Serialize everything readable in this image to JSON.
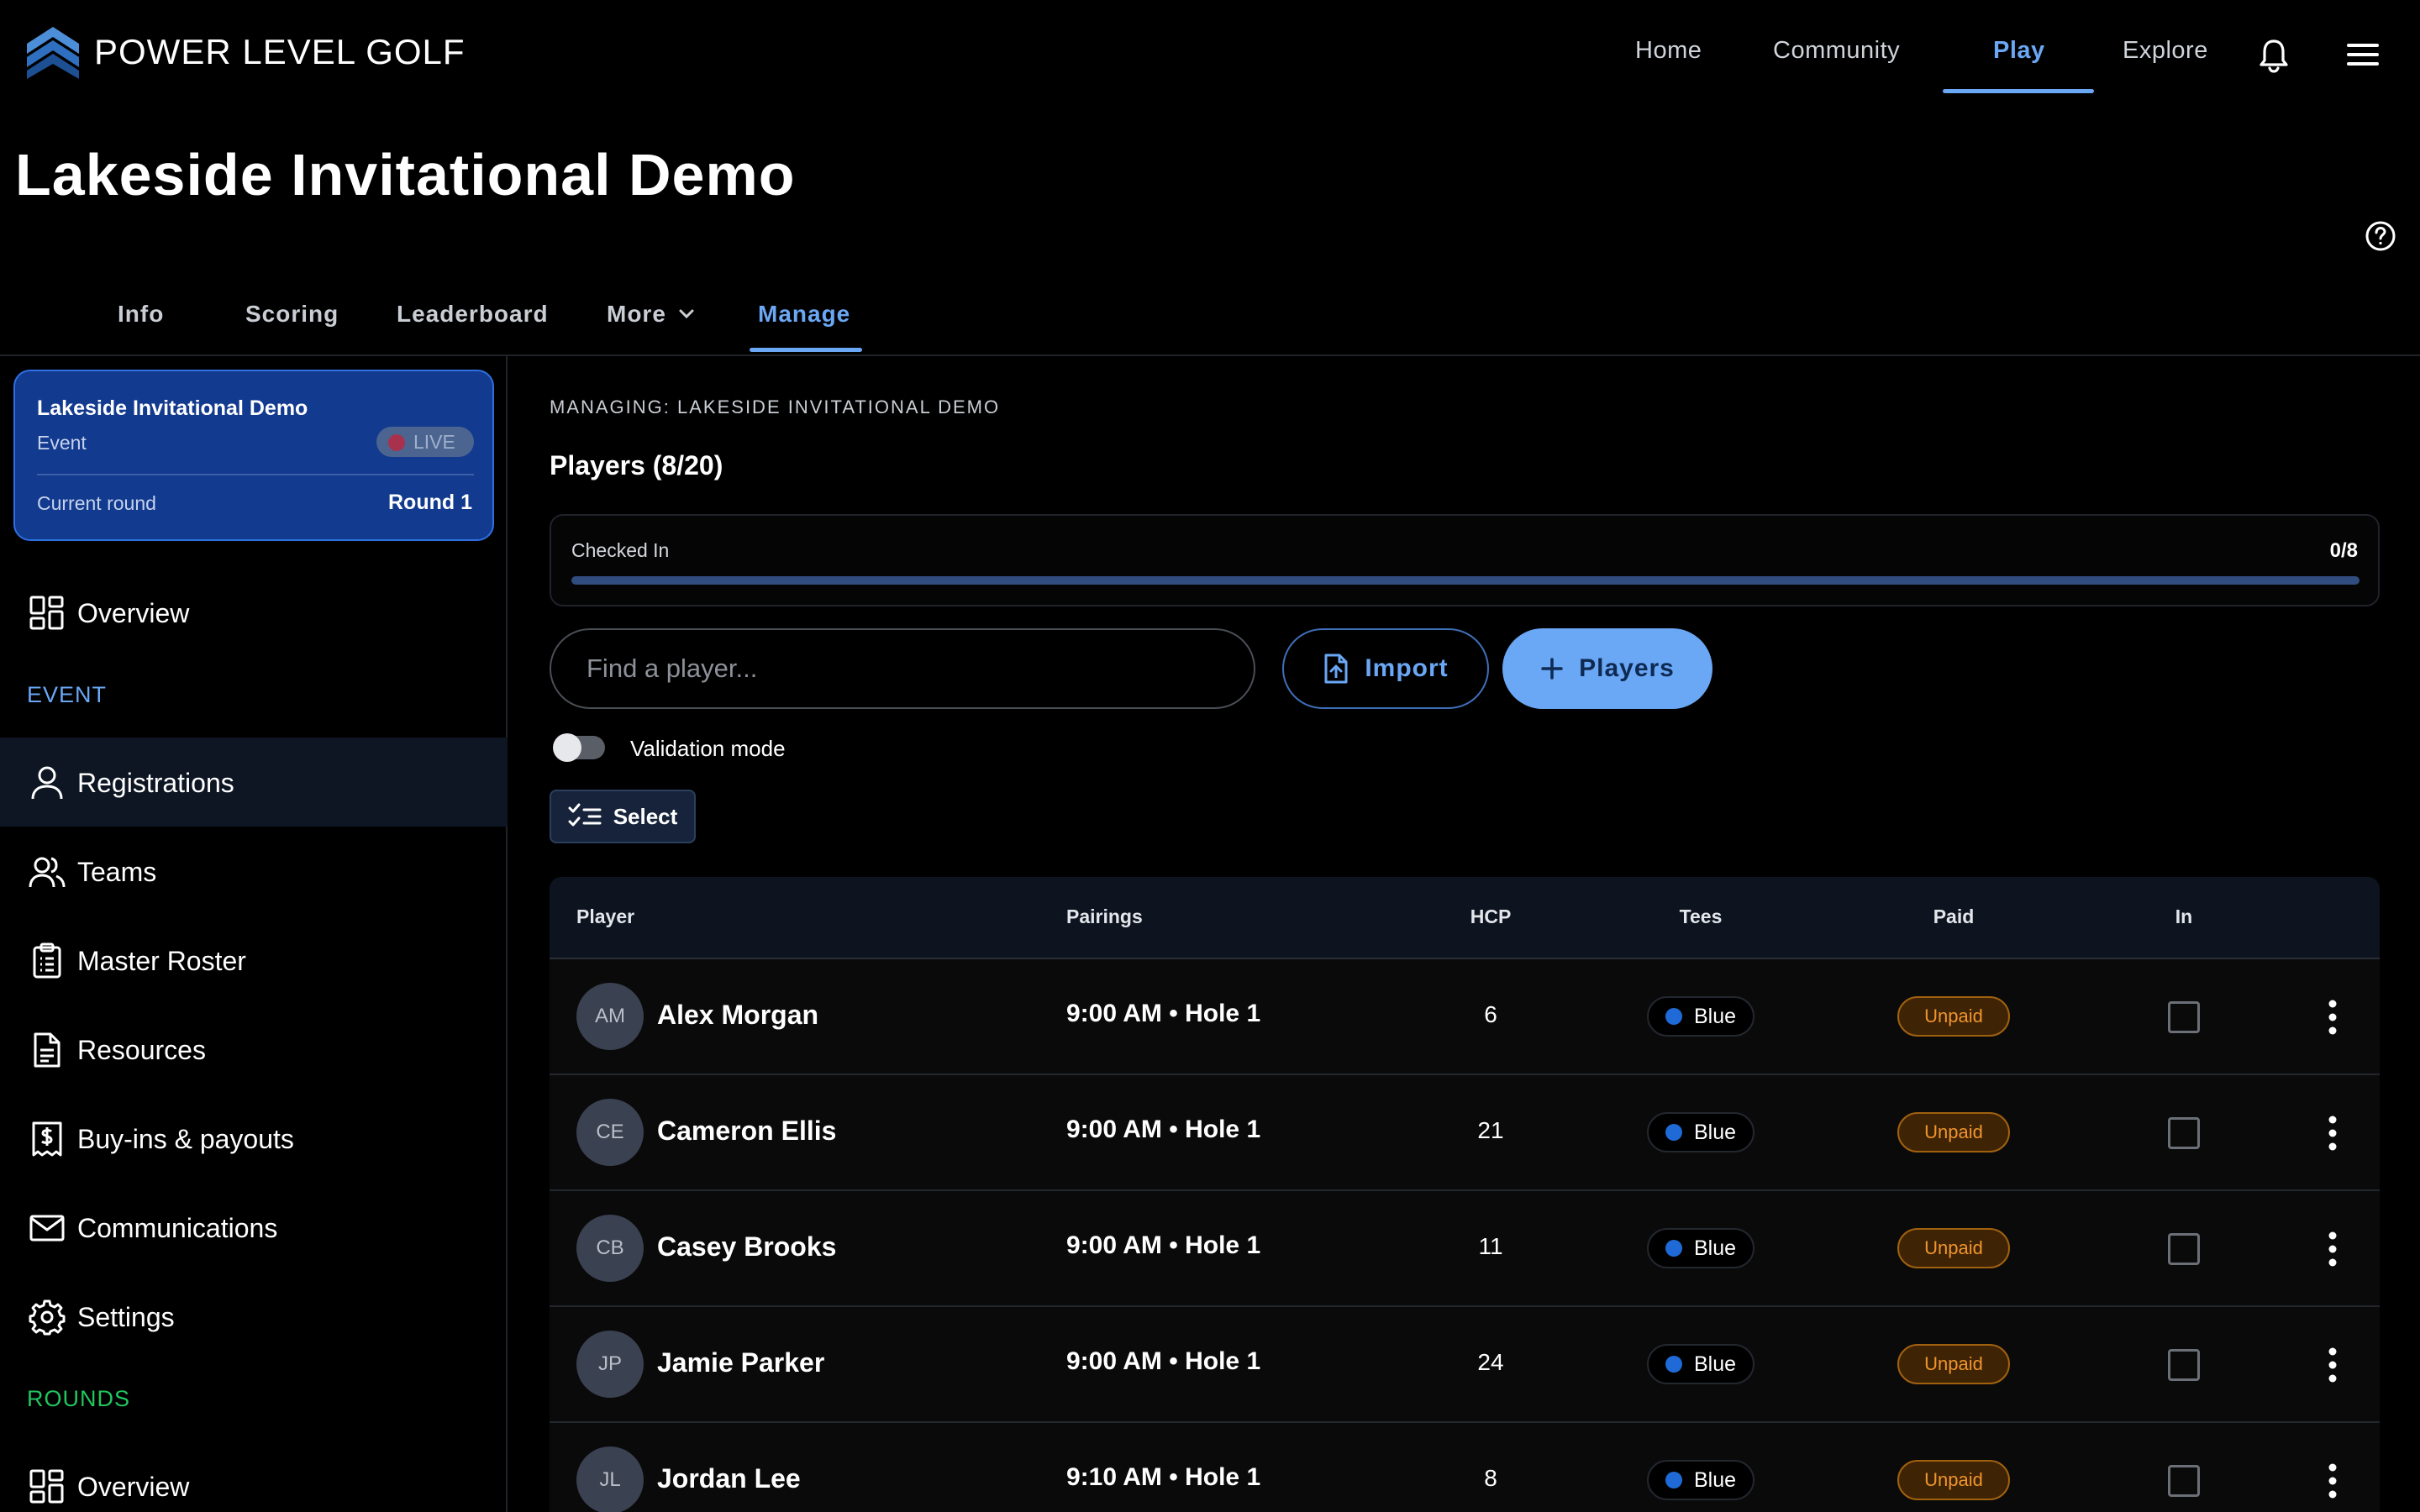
{
  "brand": {
    "name": "POWER LEVEL GOLF",
    "logo": "chevron-stack-logo"
  },
  "topnav": {
    "home": "Home",
    "community": "Community",
    "play": "Play",
    "explore": "Explore",
    "active": "Play"
  },
  "page_title": "Lakeside Invitational Demo",
  "subtabs": {
    "info": "Info",
    "scoring": "Scoring",
    "leaderboard": "Leaderboard",
    "more": "More",
    "manage": "Manage",
    "active": "Manage"
  },
  "event_card": {
    "title": "Lakeside Invitational Demo",
    "type": "Event",
    "status": "LIVE",
    "round_label": "Current round",
    "round_value": "Round 1"
  },
  "sidebar": {
    "overview": "Overview",
    "event_section": "EVENT",
    "items": [
      "Registrations",
      "Teams",
      "Master Roster",
      "Resources",
      "Buy-ins & payouts",
      "Communications",
      "Settings"
    ],
    "active": "Registrations",
    "rounds_section": "ROUNDS",
    "rounds_overview": "Overview"
  },
  "main": {
    "managing": "MANAGING: LAKESIDE INVITATIONAL DEMO",
    "players_title": "Players (8/20)",
    "checked_in_label": "Checked In",
    "checked_in_value": "0/8",
    "checked_in_fraction": 0,
    "search_placeholder": "Find a player...",
    "import_label": "Import",
    "add_players_label": "Players",
    "validation_label": "Validation mode",
    "validation_on": false,
    "select_label": "Select"
  },
  "table": {
    "headers": {
      "player": "Player",
      "pairings": "Pairings",
      "hcp": "HCP",
      "tees": "Tees",
      "paid": "Paid",
      "in": "In"
    },
    "rows": [
      {
        "initials": "AM",
        "name": "Alex Morgan",
        "pairing": "9:00 AM • Hole 1",
        "hcp": "6",
        "tee": "Blue",
        "paid": "Unpaid"
      },
      {
        "initials": "CE",
        "name": "Cameron Ellis",
        "pairing": "9:00 AM • Hole 1",
        "hcp": "21",
        "tee": "Blue",
        "paid": "Unpaid"
      },
      {
        "initials": "CB",
        "name": "Casey Brooks",
        "pairing": "9:00 AM • Hole 1",
        "hcp": "11",
        "tee": "Blue",
        "paid": "Unpaid"
      },
      {
        "initials": "JP",
        "name": "Jamie Parker",
        "pairing": "9:00 AM • Hole 1",
        "hcp": "24",
        "tee": "Blue",
        "paid": "Unpaid"
      },
      {
        "initials": "JL",
        "name": "Jordan Lee",
        "pairing": "9:10 AM • Hole 1",
        "hcp": "8",
        "tee": "Blue",
        "paid": "Unpaid"
      }
    ]
  },
  "colors": {
    "accent": "#6aa7f5",
    "event_green": "#22c55e",
    "unpaid": "#f0952d",
    "tee_blue": "#1f6ad6",
    "live_dot": "#a8324e"
  }
}
